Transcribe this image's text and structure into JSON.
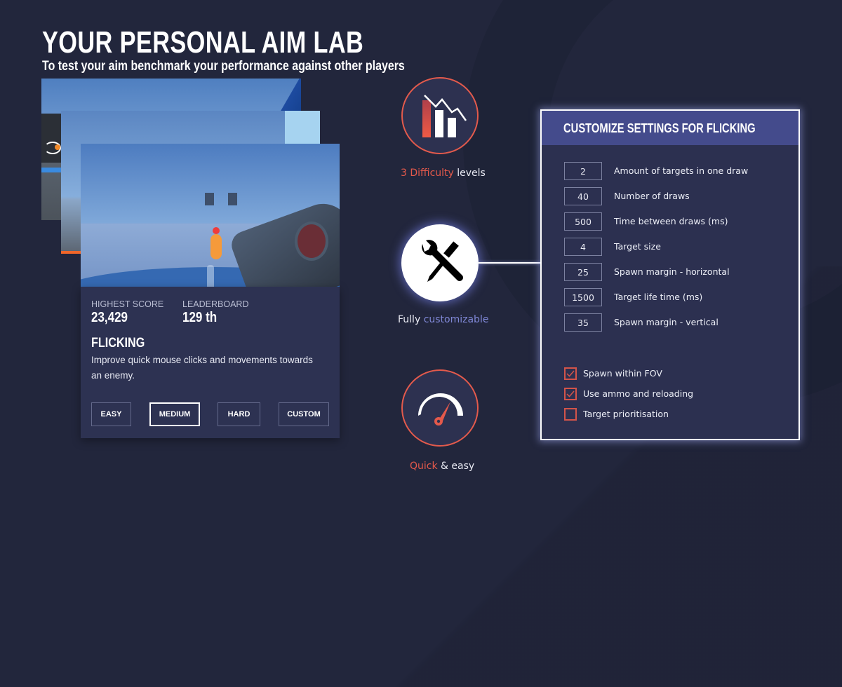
{
  "header": {
    "title": "YOUR PERSONAL AIM LAB",
    "subtitle": "To test your aim benchmark your performance against other players"
  },
  "mode_card": {
    "stats": [
      {
        "label": "HIGHEST SCORE",
        "value": "23,429"
      },
      {
        "label": "LEADERBOARD",
        "value": "129 th"
      }
    ],
    "mode_name": "FLICKING",
    "description": "Improve quick mouse clicks and movements towards an enemy.",
    "difficulty_buttons": [
      {
        "label": "EASY",
        "selected": false
      },
      {
        "label": "MEDIUM",
        "selected": true
      },
      {
        "label": "HARD",
        "selected": false
      },
      {
        "label": "CUSTOM",
        "selected": false
      }
    ]
  },
  "features": [
    {
      "icon": "chart-bars-icon",
      "highlight": "3 Difficulty",
      "rest": " levels",
      "highlight_position": "start"
    },
    {
      "icon": "tools-icon",
      "plain": "Fully ",
      "highlight": "customizable",
      "highlight_position": "end"
    },
    {
      "icon": "speedometer-icon",
      "highlight": "Quick",
      "rest": " & easy",
      "highlight_position": "start"
    }
  ],
  "settings": {
    "title": "CUSTOMIZE SETTINGS FOR FLICKING",
    "fields": [
      {
        "value": "2",
        "label": "Amount of targets in one draw"
      },
      {
        "value": "40",
        "label": "Number of draws"
      },
      {
        "value": "500",
        "label": "Time between draws (ms)"
      },
      {
        "value": "4",
        "label": "Target size"
      },
      {
        "value": "25",
        "label": "Spawn margin - horizontal"
      },
      {
        "value": "1500",
        "label": "Target life time (ms)"
      },
      {
        "value": "35",
        "label": "Spawn margin - vertical"
      }
    ],
    "checkboxes": [
      {
        "label": "Spawn within FOV",
        "checked": true
      },
      {
        "label": "Use ammo and reloading",
        "checked": true
      },
      {
        "label": "Target prioritisation",
        "checked": false
      }
    ]
  },
  "colors": {
    "background": "#22263c",
    "card": "#2d3252",
    "panel_header": "#444b8c",
    "accent_red": "#e4594b",
    "accent_blue": "#7f87d6"
  }
}
